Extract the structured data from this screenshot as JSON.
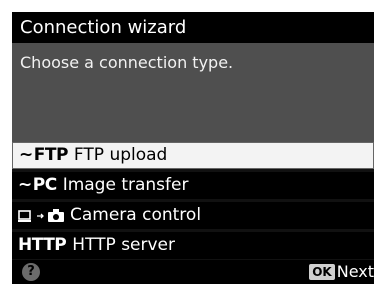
{
  "title": "Connection wizard",
  "description": "Choose a connection type.",
  "options": [
    {
      "code": "FTP",
      "label": "FTP upload",
      "icon": "wireless-ftp-icon",
      "selected": true
    },
    {
      "code": "PC",
      "label": "Image transfer",
      "icon": "wireless-pc-icon",
      "selected": false
    },
    {
      "code": "",
      "label": "Camera control",
      "icon": "computer-camera-icon",
      "selected": false
    },
    {
      "code": "HTTP",
      "label": "HTTP server",
      "icon": "http-icon",
      "selected": false
    }
  ],
  "footer": {
    "help_glyph": "?",
    "ok_key": "OK",
    "next_label": "Next"
  }
}
